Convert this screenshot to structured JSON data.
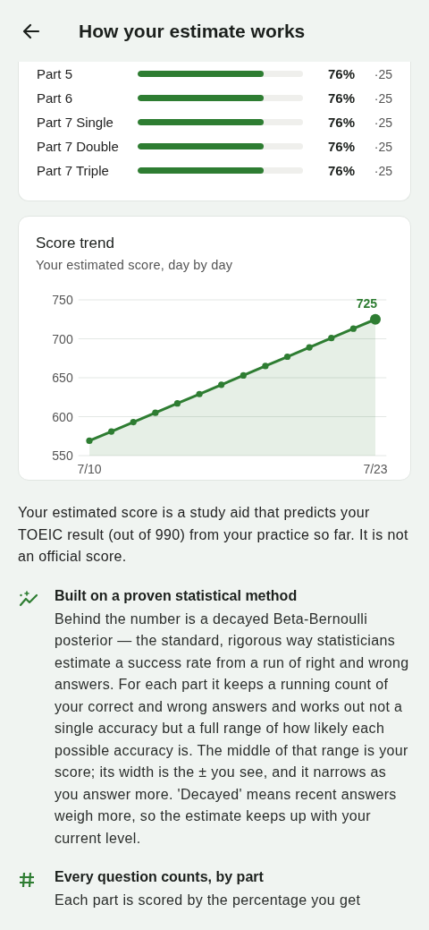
{
  "header": {
    "title": "How your estimate works"
  },
  "parts": [
    {
      "name": "Part 5",
      "level": 0.76,
      "percent": "76%",
      "count": "·25"
    },
    {
      "name": "Part 6",
      "level": 0.76,
      "percent": "76%",
      "count": "·25"
    },
    {
      "name": "Part 7 Single",
      "level": 0.76,
      "percent": "76%",
      "count": "·25"
    },
    {
      "name": "Part 7 Double",
      "level": 0.76,
      "percent": "76%",
      "count": "·25"
    },
    {
      "name": "Part 7 Triple",
      "level": 0.76,
      "percent": "76%",
      "count": "·25"
    }
  ],
  "trend": {
    "title": "Score trend",
    "subtitle": "Your estimated score, day by day",
    "chart_data": {
      "type": "area",
      "categories": [
        "7/10",
        null,
        null,
        null,
        null,
        null,
        null,
        null,
        null,
        null,
        null,
        null,
        null,
        "7/23"
      ],
      "series": [
        {
          "color": "#2e7d32",
          "values": [
            569,
            581,
            593,
            605,
            617,
            629,
            641,
            653,
            665,
            677,
            689,
            701,
            713,
            725
          ]
        }
      ],
      "ylim": [
        550,
        750
      ],
      "yticks": [
        550,
        600,
        650,
        700,
        750
      ],
      "grid": true,
      "annotations": [
        {
          "x": "7/23",
          "y": 725,
          "text": "725"
        }
      ]
    }
  },
  "intro": "Your estimated score is a study aid that predicts your TOEIC result (out of 990) from your practice so far. It is not an official score.",
  "sections": [
    {
      "kind": "trend",
      "title": "Built on a proven statistical method",
      "body": "Behind the number is a decayed Beta-Bernoulli posterior — the standard, rigorous way statisticians estimate a success rate from a run of right and wrong answers. For each part it keeps a running count of your correct and wrong answers and works out not a single accuracy but a full range of how likely each possible accuracy is. The middle of that range is your score; its width is the ± you see, and it narrows as you answer more. 'Decayed' means recent answers weigh more, so the estimate keeps up with your current level."
    },
    {
      "kind": "hash",
      "title": "Every question counts, by part",
      "body": "Each part is scored by the percentage you get"
    }
  ]
}
